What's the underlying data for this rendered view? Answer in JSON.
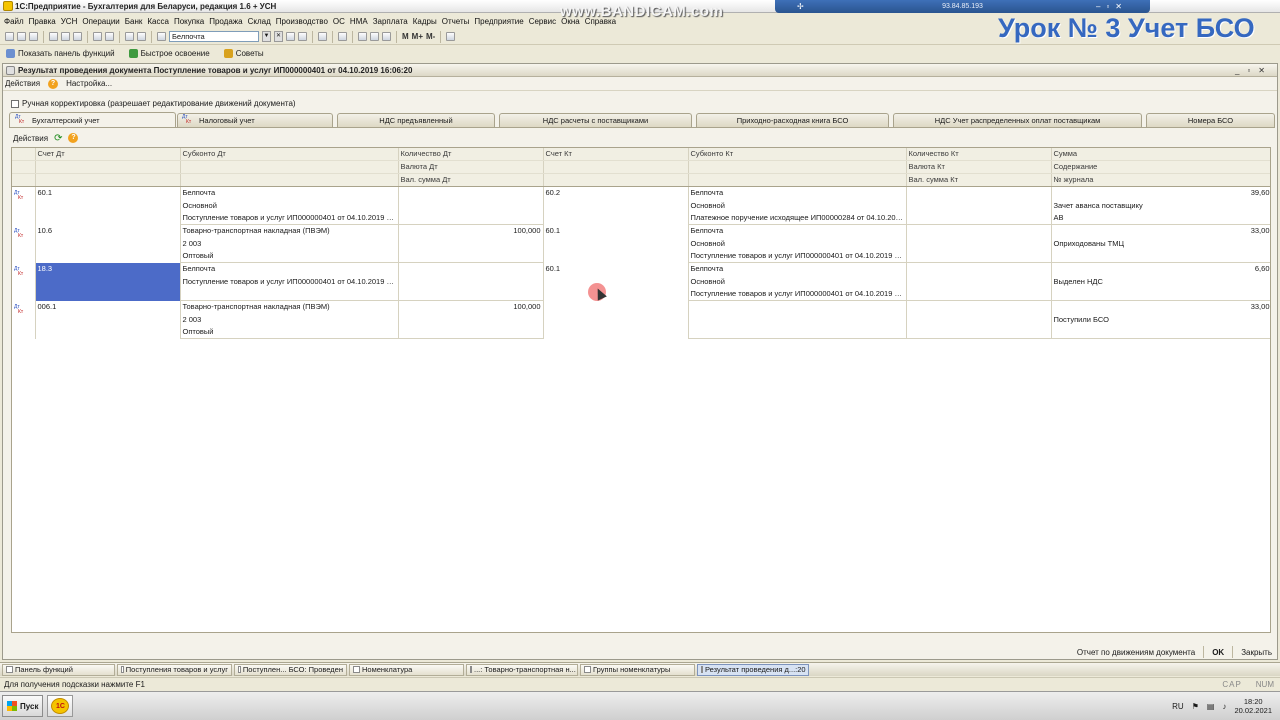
{
  "app": {
    "title": "1С:Предприятие - Бухгалтерия для Беларуси, редакция 1.6 + УСН"
  },
  "remote": {
    "ip": "93.84.85.193"
  },
  "watermark": {
    "bandicam": "www.BANDICAM.com",
    "lesson": "Урок № 3 Учет БСО"
  },
  "menu": [
    "Файл",
    "Правка",
    "УСН",
    "Операции",
    "Банк",
    "Касса",
    "Покупка",
    "Продажа",
    "Склад",
    "Производство",
    "ОС",
    "НМА",
    "Зарплата",
    "Кадры",
    "Отчеты",
    "Предприятие",
    "Сервис",
    "Окна",
    "Справка"
  ],
  "toolbar": {
    "search_value": "Белпочта",
    "m1": "М",
    "m2": "М+",
    "m3": "М-"
  },
  "toolbar2": {
    "show_panel": "Показать панель функций",
    "quick_learn": "Быстрое освоение",
    "tips": "Советы"
  },
  "window": {
    "title": "Результат проведения документа Поступление товаров и услуг ИП000000401 от 04.10.2019 16:06:20",
    "actions": "Действия",
    "settings": "Настройка...",
    "manual_label": "Ручная корректировка (разрешает редактирование движений документа)"
  },
  "tabs": [
    "Бухгалтерский учет",
    "Налоговый учет",
    "НДС предъявленный",
    "НДС расчеты с поставщиками",
    "Приходно-расходная книга БСО",
    "НДС Учет распределенных оплат поставщикам",
    "Номера БСО"
  ],
  "grid": {
    "actions": "Действия",
    "headers": [
      [
        "Счет Дт",
        "Субконто Дт",
        "Количество Дт",
        "Счет Кт",
        "Субконто Кт",
        "Количество Кт",
        "Сумма"
      ],
      [
        "",
        "",
        "Валюта Дт",
        "",
        "",
        "Валюта Кт",
        "Содержание"
      ],
      [
        "",
        "",
        "Вал. сумма Дт",
        "",
        "",
        "Вал. сумма Кт",
        "№ журнала"
      ]
    ],
    "entries": [
      {
        "debit": "60.1",
        "sub_dt": [
          "Белпочта",
          "Основной",
          "Поступление товаров и услуг ИП000000401 от 04.10.2019 16..."
        ],
        "qty_dt": [
          "",
          "",
          ""
        ],
        "credit": "60.2",
        "sub_kt": [
          "Белпочта",
          "Основной",
          "Платежное поручение исходящее ИП00000284 от 04.10.2019..."
        ],
        "qty_kt": [
          "",
          "",
          ""
        ],
        "sum": [
          "39,60",
          "Зачет аванса поставщику",
          "АВ"
        ]
      },
      {
        "debit": "10.6",
        "sub_dt": [
          "Товарно-транспортная накладная (ПВЭМ)",
          "2 003",
          "Оптовый"
        ],
        "qty_dt": [
          "100,000",
          "",
          ""
        ],
        "credit": "60.1",
        "sub_kt": [
          "Белпочта",
          "Основной",
          "Поступление товаров и услуг ИП000000401 от 04.10.2019 16..."
        ],
        "qty_kt": [
          "",
          "",
          ""
        ],
        "sum": [
          "33,00",
          "Оприходованы ТМЦ",
          ""
        ]
      },
      {
        "debit": "18.3",
        "sub_dt": [
          "Белпочта",
          "Поступление товаров и услуг ИП000000401 от 04.10.2019 16...",
          ""
        ],
        "qty_dt": [
          "",
          "",
          ""
        ],
        "credit": "60.1",
        "sub_kt": [
          "Белпочта",
          "Основной",
          "Поступление товаров и услуг ИП000000401 от 04.10.2019 16..."
        ],
        "qty_kt": [
          "",
          "",
          ""
        ],
        "sum": [
          "6,60",
          "Выделен НДС",
          ""
        ]
      },
      {
        "debit": "006.1",
        "sub_dt": [
          "Товарно-транспортная накладная (ПВЭМ)",
          "2 003",
          "Оптовый"
        ],
        "qty_dt": [
          "100,000",
          "",
          ""
        ],
        "credit": "",
        "sub_kt": [
          "",
          "",
          ""
        ],
        "qty_kt": [
          "",
          "",
          ""
        ],
        "sum": [
          "33,00",
          "Поступили БСО",
          ""
        ]
      }
    ]
  },
  "bottom": {
    "report": "Отчет по движениям документа",
    "ok": "OK",
    "close": "Закрыть"
  },
  "window_tabs": [
    "Панель функций",
    "Поступления товаров и услуг",
    "Поступлен... БСО: Проведен",
    "Номенклатура",
    "...: Товарно-транспортная н...",
    "Группы номенклатуры",
    "Результат проведения д...:20"
  ],
  "status": {
    "hint": "Для получения подсказки нажмите F1",
    "caps": "CAP",
    "num": "NUM"
  },
  "taskbar": {
    "start": "Пуск",
    "onec": "1С",
    "lang": "RU",
    "time": "18:20",
    "date": "20.02.2021"
  }
}
